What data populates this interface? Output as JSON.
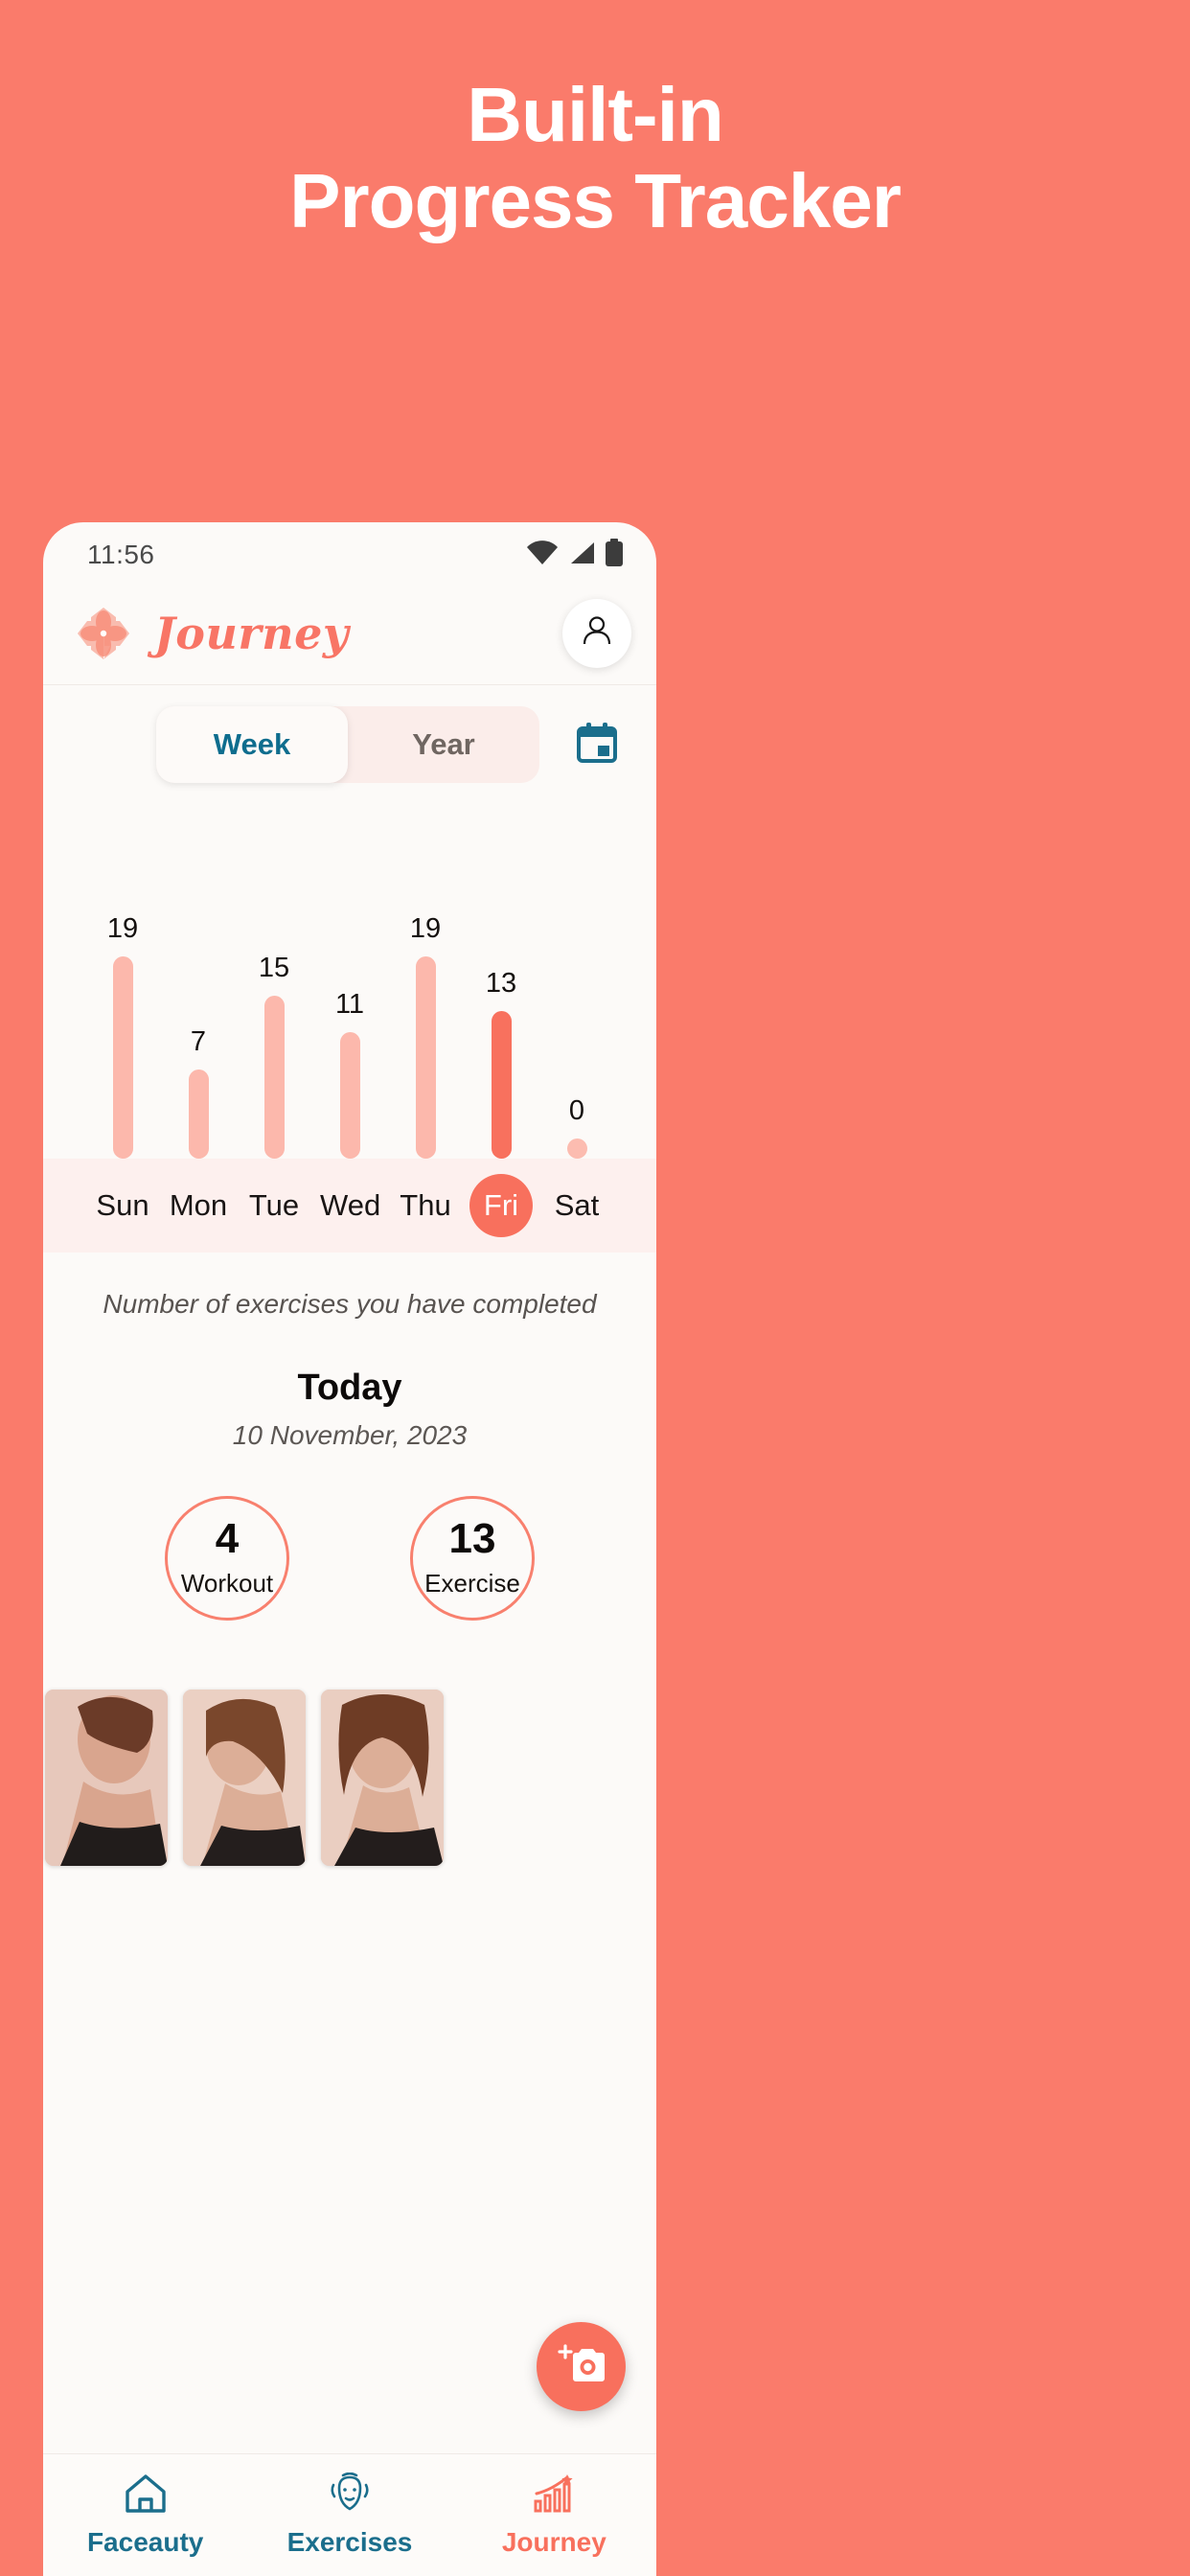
{
  "promo": {
    "line1": "Built-in",
    "line2": "Progress Tracker",
    "background_color": "#FA7B6B",
    "text_color": "#FFFFFF"
  },
  "phone": {
    "statusbar": {
      "time": "11:56",
      "icons": [
        "wifi-icon",
        "cellular-signal-icon",
        "battery-icon"
      ]
    },
    "appbar": {
      "brand": "Journey",
      "logo_icon": "lotus-flower-logo",
      "brand_color": "#F87566",
      "profile_icon": "person-avatar-icon"
    },
    "segmented": {
      "tabs": [
        {
          "label": "Week",
          "active": true
        },
        {
          "label": "Year",
          "active": false
        }
      ],
      "active_color": "#0E6D8E",
      "inactive_color": "#6F6661",
      "calendar_icon": "calendar-icon",
      "calendar_icon_color": "#1B6E8C"
    },
    "chart_caption": "Number of exercises you have completed",
    "today": {
      "heading": "Today",
      "date": "10 November, 2023",
      "stats": [
        {
          "value": "4",
          "label": "Workout"
        },
        {
          "value": "13",
          "label": "Exercise"
        }
      ],
      "stat_ring_color": "#F8806E"
    },
    "photos": [
      {
        "name": "progress-photo-chin-up"
      },
      {
        "name": "progress-photo-side-profile"
      },
      {
        "name": "progress-photo-looking-down"
      }
    ],
    "fab": {
      "icon": "add-photo-camera-icon",
      "color": "#F8705D"
    },
    "bottomnav": {
      "items": [
        {
          "label": "Faceauty",
          "icon": "home-icon",
          "active": false
        },
        {
          "label": "Exercises",
          "icon": "face-massage-icon",
          "active": false
        },
        {
          "label": "Journey",
          "icon": "bar-chart-star-icon",
          "active": true
        }
      ],
      "active_color": "#F8705D",
      "inactive_color": "#1B6E8C"
    }
  },
  "chart_data": {
    "type": "bar",
    "title": "",
    "categories": [
      "Sun",
      "Mon",
      "Tue",
      "Wed",
      "Thu",
      "Fri",
      "Sat"
    ],
    "values": [
      19,
      7,
      15,
      11,
      19,
      13,
      0
    ],
    "highlighted_category": "Fri",
    "xlabel": "",
    "ylabel": "",
    "ylim": [
      0,
      19
    ],
    "grid": false,
    "legend": false,
    "bar_color": "#FCB8AC",
    "highlight_color": "#F8715E",
    "caption": "Number of exercises you have completed"
  }
}
